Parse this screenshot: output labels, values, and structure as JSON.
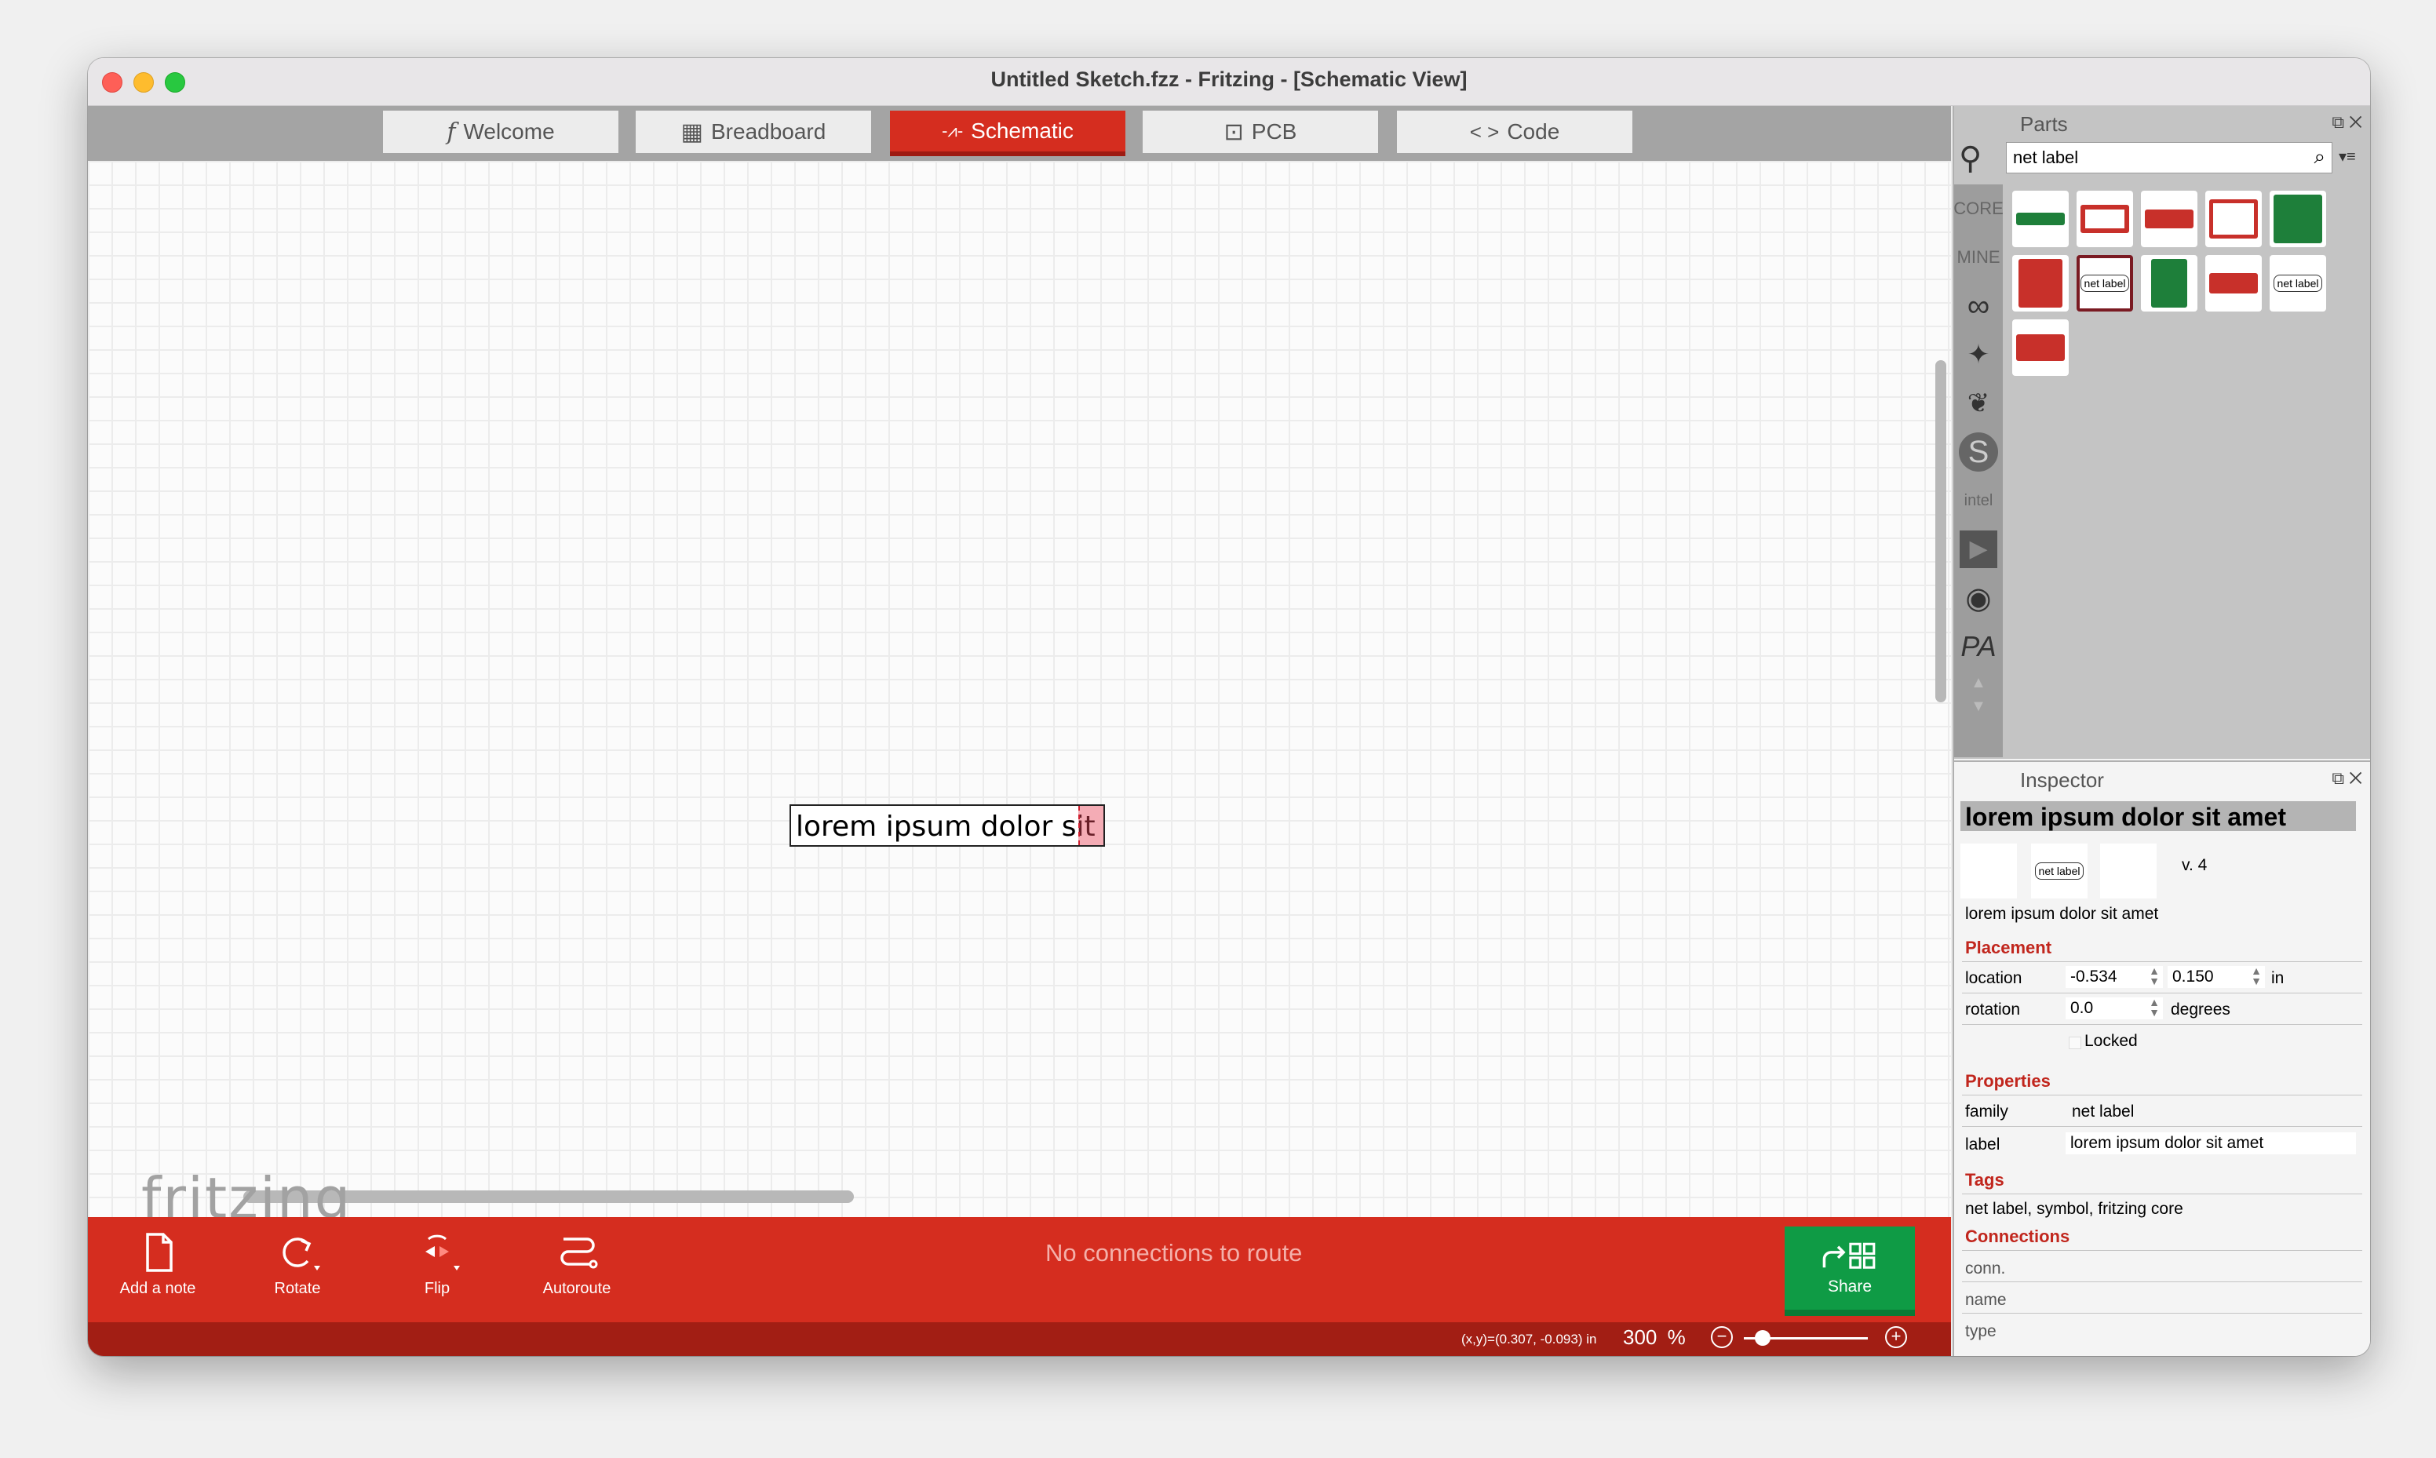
{
  "window": {
    "title": "Untitled Sketch.fzz - Fritzing - [Schematic View]"
  },
  "tabs": [
    {
      "label": "Welcome",
      "icon": "f"
    },
    {
      "label": "Breadboard",
      "icon": "▦"
    },
    {
      "label": "Schematic",
      "icon": "-⩘-"
    },
    {
      "label": "PCB",
      "icon": "⊡"
    },
    {
      "label": "Code",
      "icon": "< >"
    }
  ],
  "active_tab": "Schematic",
  "canvas": {
    "net_label_text": "lorem ipsum dolor sit an",
    "watermark": "fritzing"
  },
  "toolbar": {
    "add_note": "Add a note",
    "rotate": "Rotate",
    "flip": "Flip",
    "autoroute": "Autoroute",
    "status": "No connections to route",
    "share": "Share"
  },
  "statusbar": {
    "coords": "(x,y)=(0.307, -0.093) in",
    "zoom_value": "300",
    "zoom_unit": "%",
    "zoom_out": "⊖",
    "zoom_in": "⊕"
  },
  "parts": {
    "title": "Parts",
    "panel_controls": "⧉ ✕",
    "search_value": "net label",
    "search_menu": "▾≡",
    "bins": [
      "CORE",
      "MINE"
    ],
    "bin_icons": [
      "arduino-icon",
      "sparkfun-icon",
      "seeed-icon",
      "snootlab-icon",
      "intel-icon",
      "play-icon",
      "lilypad-icon",
      "pa-icon"
    ],
    "bin_glyphs": [
      "∞",
      "✦",
      "❦",
      "S",
      "intel",
      "▶",
      "◉",
      "PA"
    ],
    "scroll_arrows": [
      "▲",
      "▼"
    ],
    "net_label_thumb": "net label",
    "colors": {
      "green": "#1e7f3a",
      "red": "#c8302a",
      "dark": "#7a1a22"
    }
  },
  "inspector": {
    "title": "Inspector",
    "panel_controls": "⧉ ✕",
    "name": "lorem ipsum dolor sit amet",
    "version": "v. 4",
    "thumb_label": "net label",
    "description": "lorem ipsum dolor sit amet",
    "placement": {
      "heading": "Placement",
      "location_label": "location",
      "location_x": "-0.534",
      "location_y": "0.150",
      "location_unit": "in",
      "rotation_label": "rotation",
      "rotation_value": "0.0",
      "rotation_unit": "degrees",
      "locked_label": "Locked"
    },
    "properties": {
      "heading": "Properties",
      "family_label": "family",
      "family_value": "net label",
      "label_label": "label",
      "label_value": "lorem ipsum dolor sit amet"
    },
    "tags": {
      "heading": "Tags",
      "value": "net label, symbol, fritzing core"
    },
    "connections": {
      "heading": "Connections",
      "rows": [
        "conn.",
        "name",
        "type"
      ]
    }
  }
}
